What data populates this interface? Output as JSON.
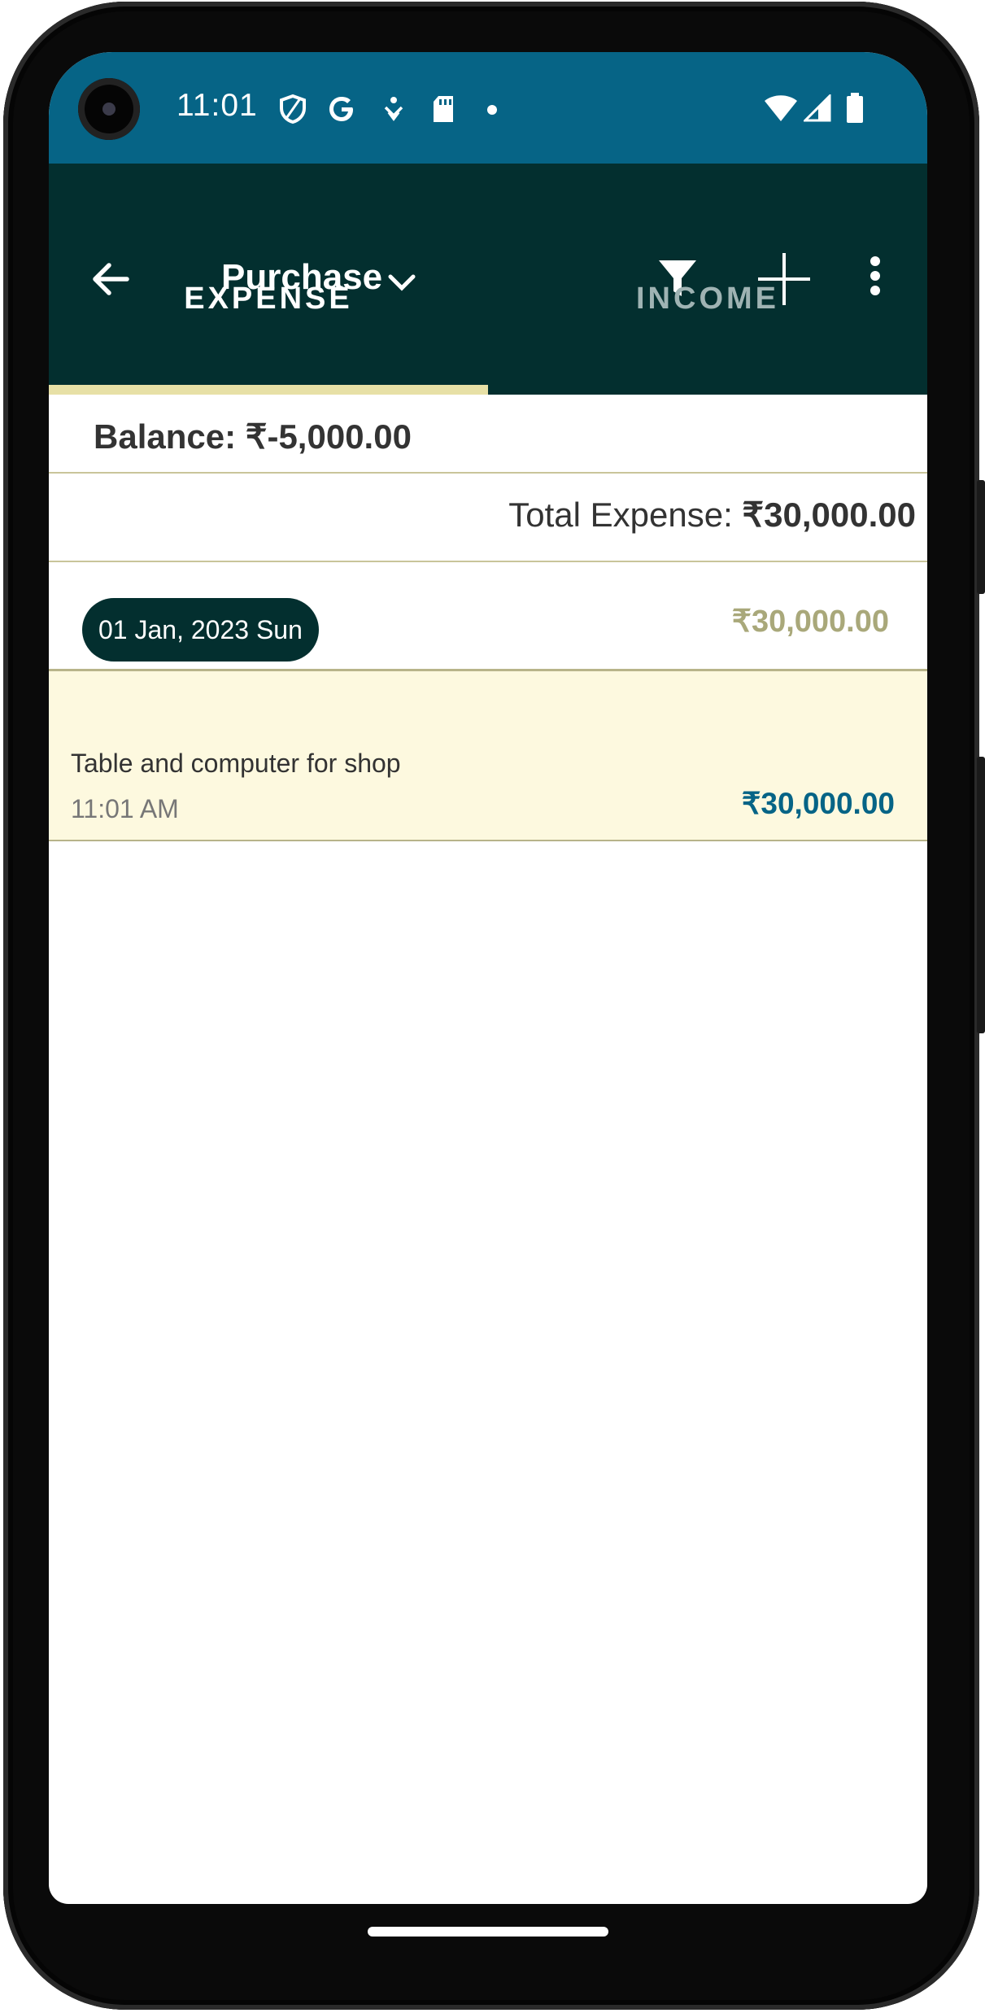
{
  "status_bar": {
    "time": "11:01",
    "icons": [
      "camera-punch-hole",
      "shield-icon",
      "google-icon",
      "heart-rate-icon",
      "sd-card-icon",
      "dot-icon",
      "wifi-icon",
      "signal-icon",
      "battery-icon"
    ]
  },
  "app_bar": {
    "title": "Purchase",
    "icons": [
      "back-arrow-icon",
      "chevron-down-icon",
      "filter-icon",
      "plus-icon",
      "more-vert-icon"
    ]
  },
  "tabs": [
    {
      "label": "EXPENSE",
      "selected": true
    },
    {
      "label": "INCOME",
      "selected": false
    }
  ],
  "summary": {
    "balance": "Balance: ₹-5,000.00",
    "total_label": "Total Expense: ",
    "total_value": "₹30,000.00"
  },
  "groups": [
    {
      "date": "01 Jan, 2023 Sun",
      "amount": "₹30,000.00",
      "transactions": [
        {
          "description": "Table and computer for shop",
          "time": "11:01 AM",
          "amount": "₹30,000.00"
        }
      ]
    }
  ],
  "colors": {
    "status_bar": "#066486",
    "app_bar": "#032f2f",
    "tab_indicator": "#e7e0a6",
    "row_highlight": "#fdf9df",
    "amount_accent": "#066486",
    "day_amount": "#a9a87a"
  }
}
